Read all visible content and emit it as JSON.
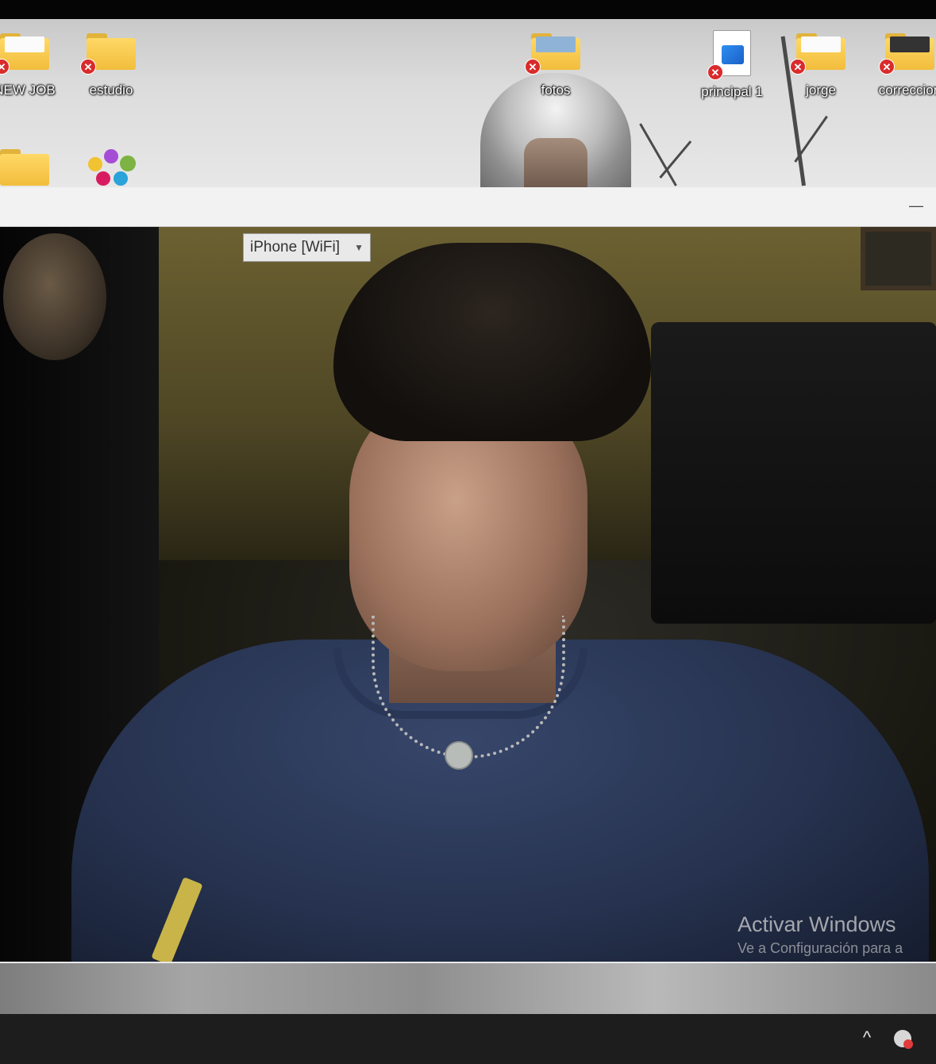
{
  "desktop": {
    "icons": [
      {
        "label": "NEW JOB",
        "type": "folder",
        "status": "error"
      },
      {
        "label": "estudio",
        "type": "folder",
        "status": "error"
      },
      {
        "label": "fotos",
        "type": "folder",
        "status": "error"
      },
      {
        "label": "principal 1",
        "type": "image-file",
        "status": "error"
      },
      {
        "label": "jorge",
        "type": "folder",
        "status": "error"
      },
      {
        "label": "correccion",
        "type": "folder",
        "status": "error"
      }
    ],
    "error_badge_glyph": "✕"
  },
  "camera_window": {
    "source_select": {
      "value": "iPhone [WiFi]"
    },
    "minimize_glyph": "—"
  },
  "watermark": {
    "title": "Activar Windows",
    "subtitle": "Ve a Configuración para a"
  },
  "taskbar": {
    "tray_chevron_glyph": "^"
  },
  "colors": {
    "error_badge": "#d92b2b",
    "taskbar": "#1d1d1d",
    "folder": "#f2bd3c"
  }
}
